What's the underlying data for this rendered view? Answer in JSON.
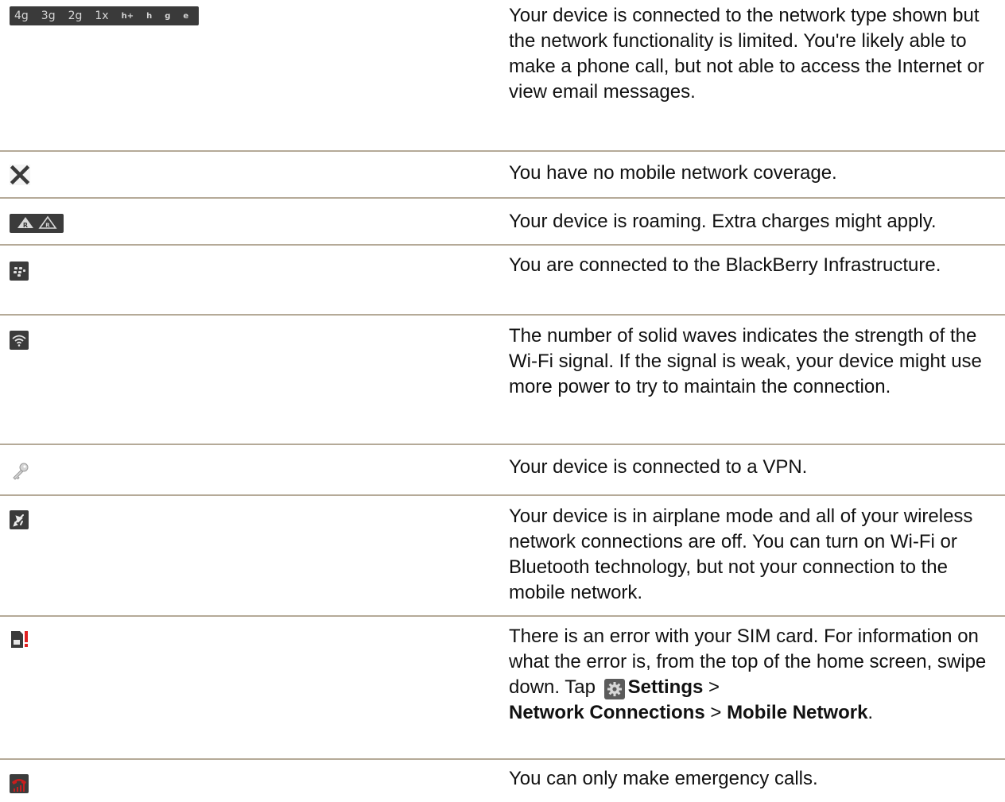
{
  "rows": [
    {
      "icon": "network-type-icons",
      "labels": [
        "4g",
        "3g",
        "2g",
        "1x",
        "h+",
        "h",
        "g",
        "e"
      ],
      "text": "Your device is connected to the network type shown but the network functionality is limited. You're likely able to make a phone call, but not able to access the Internet or view email messages."
    },
    {
      "icon": "no-coverage-icon",
      "text": "You have no mobile network coverage."
    },
    {
      "icon": "roaming-icon",
      "text": "Your device is roaming. Extra charges might apply."
    },
    {
      "icon": "blackberry-icon",
      "text": "You are connected to the BlackBerry Infrastructure."
    },
    {
      "icon": "wifi-icon",
      "text": "The number of solid waves indicates the strength of the Wi-Fi signal. If the signal is weak, your device might use more power to try to maintain the connection."
    },
    {
      "icon": "vpn-key-icon",
      "text": "Your device is connected to a VPN."
    },
    {
      "icon": "airplane-icon",
      "text": "Your device is in airplane mode and all of your wireless network connections are off. You can turn on Wi-Fi or Bluetooth technology, but not your connection to the mobile network."
    },
    {
      "icon": "sim-error-icon",
      "text_intro": "There is an error with your SIM card. For information on what the error is, from the top of the home screen, swipe down. Tap",
      "settings_label": "Settings",
      "sep1": ">",
      "network_connections_label": "Network Connections",
      "sep2": ">",
      "mobile_network_label": "Mobile Network",
      "end": "."
    },
    {
      "icon": "emergency-call-icon",
      "text": "You can only make emergency calls."
    }
  ],
  "colors": {
    "rule": "#b5aa98",
    "icon_tile": "#3b3b3b",
    "sim_error": "#e02020",
    "emergency": "#c81e1e"
  }
}
